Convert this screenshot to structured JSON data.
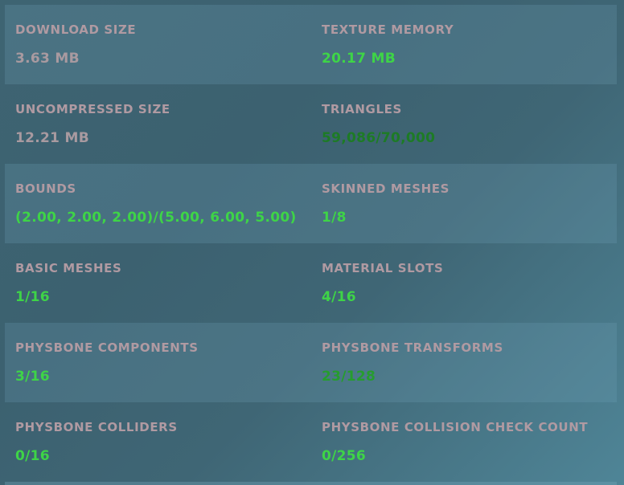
{
  "stats": [
    {
      "label": "DOWNLOAD SIZE",
      "value": "3.63 MB",
      "status": "neutral"
    },
    {
      "label": "TEXTURE MEMORY",
      "value": "20.17 MB",
      "status": "good"
    },
    {
      "label": "UNCOMPRESSED SIZE",
      "value": "12.21 MB",
      "status": "neutral"
    },
    {
      "label": "TRIANGLES",
      "value": "59,086/70,000",
      "status": "dim"
    },
    {
      "label": "BOUNDS",
      "value": "(2.00, 2.00, 2.00)/(5.00, 6.00, 5.00)",
      "status": "good"
    },
    {
      "label": "SKINNED MESHES",
      "value": "1/8",
      "status": "good"
    },
    {
      "label": "BASIC MESHES",
      "value": "1/16",
      "status": "good"
    },
    {
      "label": "MATERIAL SLOTS",
      "value": "4/16",
      "status": "good"
    },
    {
      "label": "PHYSBONE COMPONENTS",
      "value": "3/16",
      "status": "good"
    },
    {
      "label": "PHYSBONE TRANSFORMS",
      "value": "23/128",
      "status": "ok"
    },
    {
      "label": "PHYSBONE COLLIDERS",
      "value": "0/16",
      "status": "good"
    },
    {
      "label": "PHYSBONE COLLISION CHECK COUNT",
      "value": "0/256",
      "status": "good"
    }
  ],
  "colors": {
    "label": "#b09aa2",
    "neutral": "#a99aa0",
    "good": "#3ed447",
    "ok": "#269d2e",
    "dim": "#1d7b25",
    "background": "#3e6472"
  }
}
